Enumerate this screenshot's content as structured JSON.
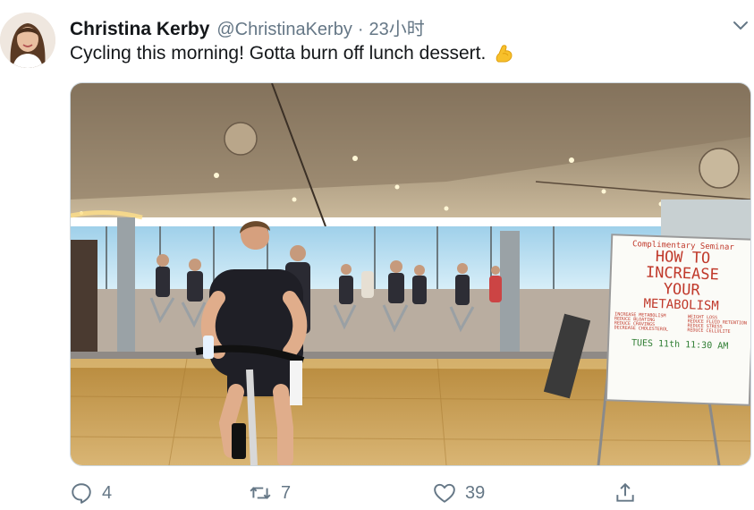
{
  "tweet": {
    "author_name": "Christina Kerby",
    "author_handle": "@ChristinaKerby",
    "separator": "·",
    "timestamp": "23小时",
    "text": "Cycling this morning! Gotta burn off lunch dessert.",
    "emoji_icon": "flexed-biceps-icon"
  },
  "whiteboard": {
    "line1": "Complimentary Seminar",
    "line2": "HOW TO",
    "line3": "INCREASE",
    "line4": "YOUR",
    "line5": "METABOLISM",
    "left_notes": [
      "INCREASE METABOLISM",
      "REDUCE BLOATING",
      "REDUCE CRAVINGS",
      "DECREASE CHOLESTEROL"
    ],
    "right_notes": [
      "WEIGHT LOSS",
      "REDUCE FLUID RETENTION",
      "REDUCE STRESS",
      "REDUCE CELLULITE"
    ],
    "schedule": "TUES 11th 11:30 AM"
  },
  "actions": {
    "replies": "4",
    "retweets": "7",
    "likes": "39"
  },
  "colors": {
    "text": "#14171a",
    "secondary": "#657786",
    "border": "#ccd6dd",
    "board_ink": "#c0392b"
  }
}
